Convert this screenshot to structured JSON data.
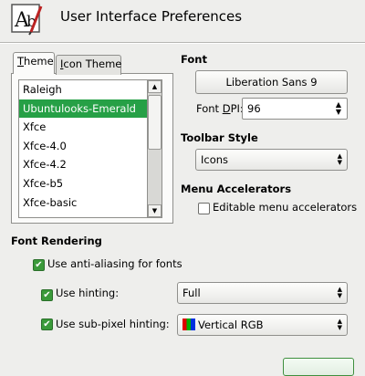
{
  "window": {
    "title": "User Interface Preferences"
  },
  "tabs": [
    {
      "label_prefix": "",
      "mnemonic": "T",
      "label_rest": "heme",
      "selected": true
    },
    {
      "label_prefix": "",
      "mnemonic": "I",
      "label_rest": "con Theme",
      "selected": false
    }
  ],
  "theme_list": {
    "items": [
      "Raleigh",
      "Ubuntulooks-Emerald",
      "Xfce",
      "Xfce-4.0",
      "Xfce-4.2",
      "Xfce-b5",
      "Xfce-basic"
    ],
    "selected_index": 1
  },
  "font": {
    "section_title": "Font",
    "font_button_label": "Liberation Sans 9",
    "dpi_label_prefix": "Font ",
    "dpi_label_mnemonic": "D",
    "dpi_label_suffix": "PI:",
    "dpi_value": "96"
  },
  "toolbar_style": {
    "section_title": "Toolbar Style",
    "selected": "Icons"
  },
  "menu_accelerators": {
    "section_title": "Menu Accelerators",
    "editable_label": "Editable menu accelerators",
    "editable_checked": false
  },
  "font_rendering": {
    "section_title": "Font Rendering",
    "antialias_label": "Use anti-aliasing for fonts",
    "antialias_checked": true,
    "hinting_label": "Use hinting:",
    "hinting_checked": true,
    "hinting_value": "Full",
    "subpixel_label": "Use sub-pixel hinting:",
    "subpixel_checked": true,
    "subpixel_value": "Vertical RGB"
  },
  "colors": {
    "selection": "#26a046",
    "window_bg": "#eeeeec",
    "checkbox_checked": "#3a9a3a"
  },
  "icons": {
    "app_icon": "font-preferences-icon",
    "check": "✔",
    "spin_up": "▲",
    "spin_down": "▼"
  }
}
